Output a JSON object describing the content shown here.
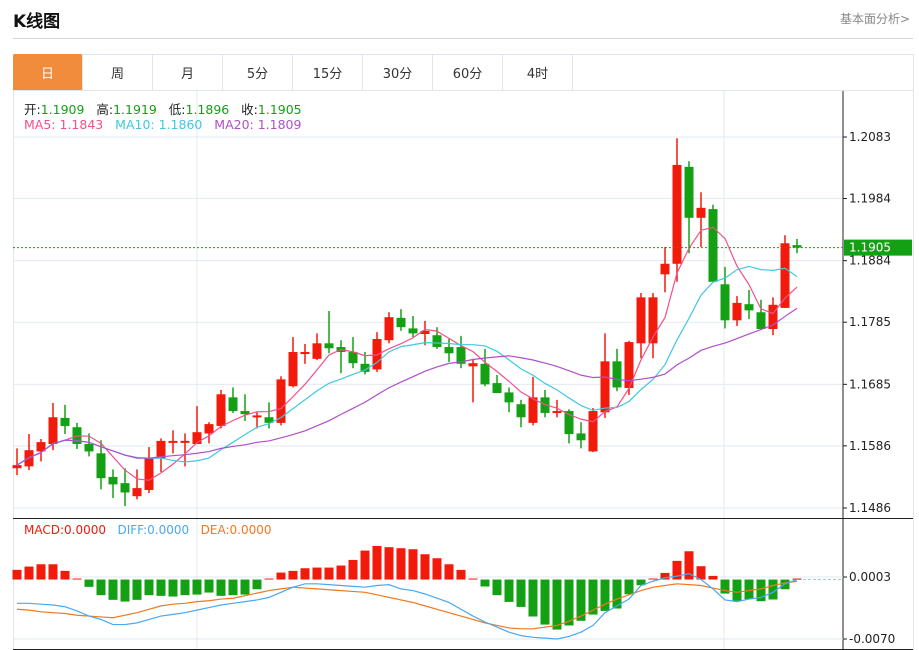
{
  "header": {
    "title": "K线图",
    "link": "基本面分析>"
  },
  "tabs": [
    {
      "label": "日",
      "active": true
    },
    {
      "label": "周"
    },
    {
      "label": "月"
    },
    {
      "label": "5分"
    },
    {
      "label": "15分"
    },
    {
      "label": "30分"
    },
    {
      "label": "60分"
    },
    {
      "label": "4时"
    }
  ],
  "ohlc_legend": {
    "open_label": "开:",
    "open": "1.1909",
    "high_label": "高:",
    "high": "1.1919",
    "low_label": "低:",
    "low": "1.1896",
    "close_label": "收:",
    "close": "1.1905"
  },
  "ma_legend": {
    "ma5_label": "MA5:",
    "ma5": "1.1843",
    "ma10_label": "MA10:",
    "ma10": "1.1860",
    "ma20_label": "MA20:",
    "ma20": "1.1809"
  },
  "macd_legend": {
    "macd_label": "MACD:",
    "macd": "0.0000",
    "diff_label": "DIFF:",
    "diff": "0.0000",
    "dea_label": "DEA:",
    "dea": "0.0000"
  },
  "current_price": "1.1905",
  "colors": {
    "accent_tab": "#f08c3c",
    "up": "#f21a0a",
    "down": "#14a014",
    "ma5": "#f0508c",
    "ma10": "#40c8e0",
    "ma20": "#b050c8",
    "diff": "#4aa8f0",
    "dea": "#f07820",
    "price_line": "#14a014"
  },
  "chart_data": [
    {
      "type": "candlestick",
      "title": "",
      "y_ticks": [
        "1.2083",
        "1.1984",
        "1.1884",
        "1.1785",
        "1.1685",
        "1.1586",
        "1.1486"
      ],
      "ylim": [
        1.1486,
        1.2083
      ],
      "grid": true,
      "moving_averages": [
        5,
        10,
        20
      ],
      "open": [
        1.155,
        1.1553,
        1.1577,
        1.1589,
        1.1631,
        1.1616,
        1.1589,
        1.1574,
        1.1536,
        1.1526,
        1.1505,
        1.1515,
        1.1566,
        1.1592,
        1.1592,
        1.1589,
        1.1606,
        1.1618,
        1.1664,
        1.1642,
        1.1632,
        1.1632,
        1.1623,
        1.1682,
        1.1735,
        1.1726,
        1.1751,
        1.1745,
        1.1737,
        1.1718,
        1.1709,
        1.1756,
        1.1792,
        1.1775,
        1.1766,
        1.1764,
        1.1745,
        1.1745,
        1.1714,
        1.1718,
        1.1687,
        1.1672,
        1.1653,
        1.1623,
        1.1664,
        1.1639,
        1.1642,
        1.1606,
        1.1577,
        1.164,
        1.1722,
        1.1679,
        1.1751,
        1.1751,
        1.1862,
        1.1879,
        1.2035,
        1.1953,
        1.1967,
        1.1846,
        1.1788,
        1.1814,
        1.1801,
        1.1774,
        1.1808,
        1.1909
      ],
      "high": [
        1.1582,
        1.1605,
        1.1597,
        1.1655,
        1.1652,
        1.1623,
        1.1606,
        1.1595,
        1.1548,
        1.155,
        1.1548,
        1.1584,
        1.1598,
        1.1611,
        1.1606,
        1.165,
        1.1624,
        1.1676,
        1.168,
        1.1669,
        1.164,
        1.1656,
        1.1698,
        1.1761,
        1.175,
        1.1767,
        1.1803,
        1.1756,
        1.1761,
        1.1737,
        1.1769,
        1.1801,
        1.1806,
        1.1795,
        1.1787,
        1.1777,
        1.1758,
        1.1763,
        1.1726,
        1.1742,
        1.17,
        1.168,
        1.166,
        1.1697,
        1.1676,
        1.166,
        1.1645,
        1.1624,
        1.1647,
        1.1767,
        1.1742,
        1.1755,
        1.1832,
        1.1832,
        1.1906,
        1.2081,
        1.2044,
        1.1994,
        1.1974,
        1.1874,
        1.1827,
        1.1837,
        1.1821,
        1.1825,
        1.1925,
        1.1919
      ],
      "low": [
        1.1539,
        1.1547,
        1.1561,
        1.1579,
        1.1605,
        1.1581,
        1.1569,
        1.1516,
        1.1502,
        1.1489,
        1.15,
        1.151,
        1.1544,
        1.1574,
        1.1553,
        1.1589,
        1.159,
        1.1614,
        1.1639,
        1.1626,
        1.1614,
        1.1614,
        1.1619,
        1.168,
        1.1718,
        1.1724,
        1.1735,
        1.1703,
        1.1711,
        1.1701,
        1.1705,
        1.1751,
        1.1771,
        1.1761,
        1.1748,
        1.1742,
        1.1721,
        1.1711,
        1.1656,
        1.1682,
        1.1671,
        1.164,
        1.1616,
        1.1619,
        1.1632,
        1.1632,
        1.159,
        1.1582,
        1.1576,
        1.1631,
        1.1674,
        1.1668,
        1.1727,
        1.1727,
        1.1833,
        1.185,
        1.1896,
        1.1906,
        1.185,
        1.1775,
        1.1779,
        1.179,
        1.1774,
        1.1764,
        1.1808,
        1.1896
      ],
      "close": [
        1.1555,
        1.1579,
        1.1592,
        1.1632,
        1.1618,
        1.1589,
        1.1577,
        1.1534,
        1.1524,
        1.1511,
        1.1518,
        1.1566,
        1.1594,
        1.1594,
        1.1594,
        1.1608,
        1.1621,
        1.1669,
        1.1642,
        1.1637,
        1.1635,
        1.1623,
        1.1693,
        1.1737,
        1.1737,
        1.1751,
        1.1743,
        1.1737,
        1.1719,
        1.1705,
        1.1758,
        1.1793,
        1.1777,
        1.1767,
        1.1771,
        1.1745,
        1.1735,
        1.1718,
        1.1719,
        1.1685,
        1.1671,
        1.1656,
        1.1632,
        1.1664,
        1.1639,
        1.1642,
        1.1605,
        1.1595,
        1.1642,
        1.1722,
        1.168,
        1.1753,
        1.1825,
        1.1825,
        1.1879,
        1.2038,
        1.1953,
        1.1969,
        1.185,
        1.1788,
        1.1816,
        1.1804,
        1.1774,
        1.1813,
        1.1912,
        1.1905
      ]
    },
    {
      "type": "bar",
      "title": "",
      "y_ticks": [
        "0.0003",
        "-0.0070"
      ],
      "ylim": [
        -0.007,
        0.0003
      ],
      "macd": [
        0.00114,
        0.00153,
        0.0018,
        0.0018,
        0.00102,
        0.0001,
        -0.00086,
        -0.00184,
        -0.00239,
        -0.00259,
        -0.00239,
        -0.00184,
        -0.00192,
        -0.002,
        -0.00184,
        -0.00177,
        -0.00153,
        -0.00192,
        -0.00184,
        -0.00177,
        -0.00114,
        0.0001,
        0.00082,
        0.00102,
        0.00133,
        0.00141,
        0.00141,
        0.00165,
        0.00231,
        0.00341,
        0.00396,
        0.00381,
        0.00369,
        0.00357,
        0.00298,
        0.00251,
        0.0018,
        0.00114,
        0.0001,
        -0.00082,
        -0.00184,
        -0.00263,
        -0.00322,
        -0.00435,
        -0.0053,
        -0.00589,
        -0.00541,
        -0.00486,
        -0.00412,
        -0.00369,
        -0.00341,
        -0.00173,
        -0.00067,
        0.0001,
        0.00078,
        0.0022,
        0.00333,
        0.00157,
        0.00043,
        -0.00165,
        -0.00251,
        -0.00231,
        -0.00255,
        -0.00235,
        -0.00114,
        0.0
      ],
      "diff": [
        -0.0028,
        -0.0028,
        -0.0029,
        -0.003,
        -0.0032,
        -0.0037,
        -0.0043,
        -0.0047,
        -0.0053,
        -0.0053,
        -0.0051,
        -0.0047,
        -0.0043,
        -0.0041,
        -0.0039,
        -0.0036,
        -0.0033,
        -0.003,
        -0.0028,
        -0.0026,
        -0.0024,
        -0.0021,
        -0.0015,
        -0.0009,
        -0.0005,
        -0.0005,
        -0.0006,
        -0.0007,
        -0.0008,
        -0.0009,
        -0.0007,
        -0.0006,
        -0.0011,
        -0.0013,
        -0.0017,
        -0.0022,
        -0.0027,
        -0.0035,
        -0.0043,
        -0.005,
        -0.0056,
        -0.0062,
        -0.0066,
        -0.0068,
        -0.0069,
        -0.007,
        -0.0067,
        -0.0062,
        -0.0054,
        -0.0039,
        -0.0031,
        -0.0023,
        -0.0007,
        -0.0002,
        0.0002,
        0.0004,
        0.0007,
        0.0,
        -0.0011,
        -0.0024,
        -0.0026,
        -0.0023,
        -0.0021,
        -0.0015,
        -0.0005,
        0.0
      ],
      "dea": [
        -0.0035,
        -0.0036,
        -0.0038,
        -0.0039,
        -0.004,
        -0.0042,
        -0.0043,
        -0.0044,
        -0.0045,
        -0.0042,
        -0.0039,
        -0.0035,
        -0.0031,
        -0.0029,
        -0.0028,
        -0.0026,
        -0.0025,
        -0.0023,
        -0.0022,
        -0.0019,
        -0.0016,
        -0.0013,
        -0.0011,
        -0.0009,
        -0.001,
        -0.0011,
        -0.0012,
        -0.0013,
        -0.0014,
        -0.0015,
        -0.0018,
        -0.0021,
        -0.0024,
        -0.0027,
        -0.0031,
        -0.0035,
        -0.0039,
        -0.0043,
        -0.0047,
        -0.0051,
        -0.0054,
        -0.0057,
        -0.0058,
        -0.0058,
        -0.0056,
        -0.0054,
        -0.0049,
        -0.0043,
        -0.0036,
        -0.0029,
        -0.0023,
        -0.0018,
        -0.0013,
        -0.0009,
        -0.0007,
        -0.0005,
        -0.0006,
        -0.0007,
        -0.001,
        -0.0013,
        -0.0015,
        -0.0013,
        -0.0011,
        -0.0007,
        -0.0004,
        -0.0002
      ]
    }
  ]
}
